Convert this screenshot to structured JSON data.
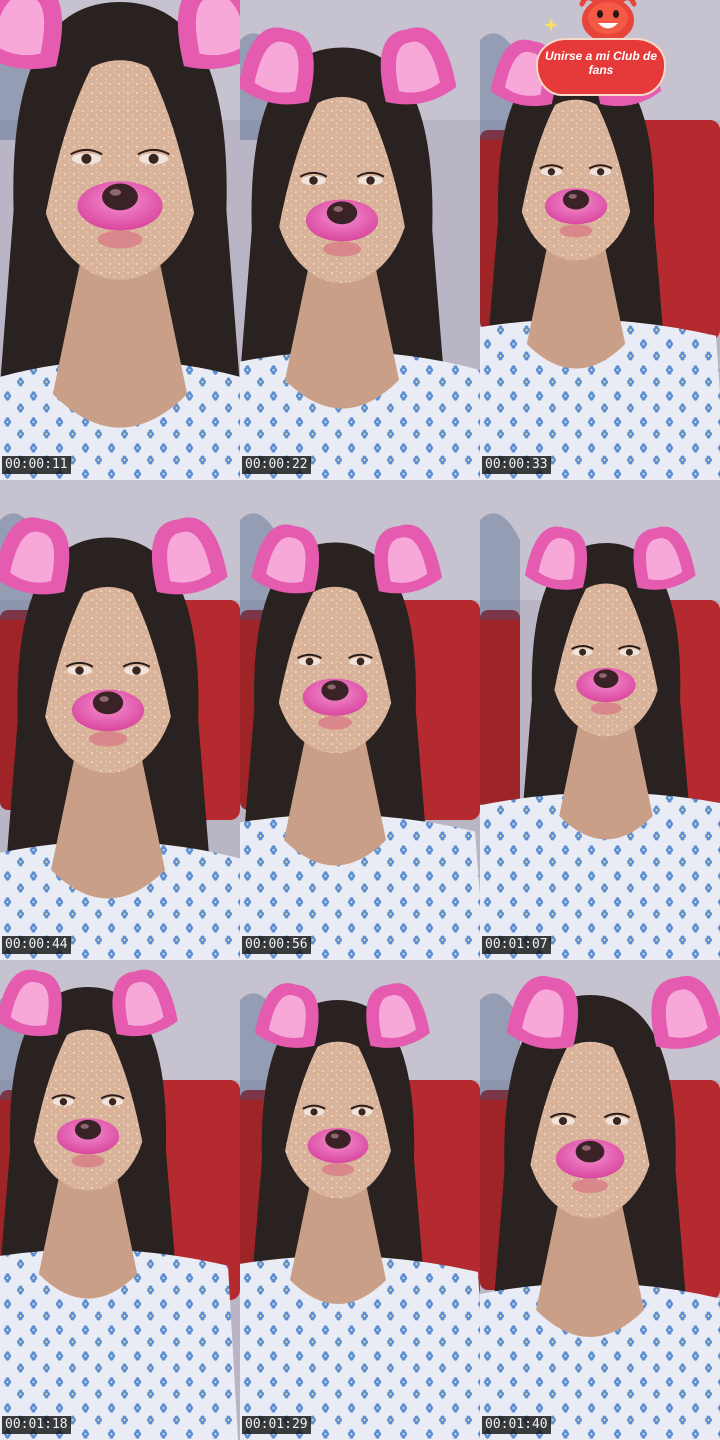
{
  "frames": [
    {
      "time": "00:00:11"
    },
    {
      "time": "00:00:22"
    },
    {
      "time": "00:00:33"
    },
    {
      "time": "00:00:44"
    },
    {
      "time": "00:00:56"
    },
    {
      "time": "00:01:07"
    },
    {
      "time": "00:01:18"
    },
    {
      "time": "00:01:29"
    },
    {
      "time": "00:01:40"
    }
  ],
  "overlay": {
    "fan_club_label": "Unirse a mi Club de fans"
  },
  "colors": {
    "ears": "#e45bb0",
    "ear_inner": "#f7a8d8",
    "nose_muzzle": "#e85cb8",
    "nose": "#3a2226",
    "hair": "#2a2220",
    "skin": "#d8b29a",
    "shirt": "#e9ecf4",
    "flowers": "#5d8fd6",
    "wall": "#b9b5c4",
    "red_chair": "#b52a2e",
    "badge": "#e63a3a"
  },
  "icons": {
    "fan_club_mascot": "smiling-red-mascot-icon",
    "sparkle": "sparkle-icon"
  }
}
